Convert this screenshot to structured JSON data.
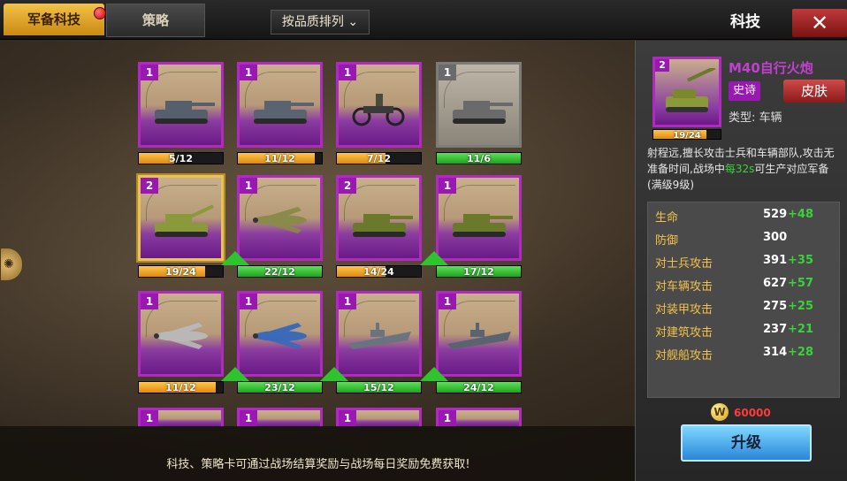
{
  "tabs": [
    {
      "label": "军备科技"
    },
    {
      "label": "策略"
    }
  ],
  "sort_label": "按品质排列",
  "header_title": "科技",
  "close_icon": "✕",
  "cards": [
    {
      "level": "1",
      "progress": "5/12",
      "bar": "orange",
      "fill": 0.42,
      "unit": "tank",
      "color": "#56606c"
    },
    {
      "level": "1",
      "progress": "11/12",
      "bar": "orange",
      "fill": 0.92,
      "unit": "tank-destroyer",
      "color": "#5a6470"
    },
    {
      "level": "1",
      "progress": "7/12",
      "bar": "orange",
      "fill": 0.58,
      "unit": "motorcycle",
      "color": "#3a3a3a"
    },
    {
      "level": "1",
      "progress": "11/6",
      "bar": "green",
      "fill": 1,
      "unit": "sp-gun-gray",
      "color": "#6a6a6a",
      "gray": true
    },
    {
      "level": "2",
      "progress": "19/24",
      "bar": "orange",
      "fill": 0.79,
      "unit": "sp-artillery",
      "color": "#8a9a3a",
      "selected": true
    },
    {
      "level": "1",
      "progress": "22/12",
      "bar": "green",
      "fill": 1,
      "unit": "plane-p47",
      "color": "#8a8a4a",
      "arrow": true
    },
    {
      "level": "2",
      "progress": "14/24",
      "bar": "orange",
      "fill": 0.58,
      "unit": "tank-green",
      "color": "#6a7a2a"
    },
    {
      "level": "1",
      "progress": "17/12",
      "bar": "green",
      "fill": 1,
      "unit": "tank-m36",
      "color": "#6a7a2a",
      "arrow": true
    },
    {
      "level": "1",
      "progress": "11/12",
      "bar": "orange",
      "fill": 0.92,
      "unit": "plane-spitfire",
      "color": "#b8b8b8"
    },
    {
      "level": "1",
      "progress": "23/12",
      "bar": "green",
      "fill": 1,
      "unit": "plane-corsair",
      "color": "#3a6ab8",
      "arrow": true
    },
    {
      "level": "1",
      "progress": "15/12",
      "bar": "green",
      "fill": 1,
      "unit": "warship",
      "color": "#6a7480",
      "arrow": true
    },
    {
      "level": "1",
      "progress": "24/12",
      "bar": "green",
      "fill": 1,
      "unit": "battleship",
      "color": "#5a6470",
      "arrow": true
    }
  ],
  "extra_row_levels": [
    "1",
    "1",
    "1",
    "1"
  ],
  "tip": "科技、策略卡可通过战场结算奖励与战场每日奖励免费获取!",
  "detail": {
    "level": "2",
    "progress": "19/24",
    "progress_fill": 0.79,
    "name": "M40自行火炮",
    "rarity": "史诗",
    "skin_label": "皮肤",
    "type_label": "类型: 车辆",
    "desc_prefix": "射程远,擅长攻击士兵和车辆部队,攻击无准备时间,战场中",
    "desc_highlight": "每32s",
    "desc_suffix": "可生产对应军备(满级9级)",
    "stats": [
      {
        "label": "生命",
        "value": "529",
        "bonus": "+48"
      },
      {
        "label": "防御",
        "value": "300",
        "bonus": ""
      },
      {
        "label": "对士兵攻击",
        "value": "391",
        "bonus": "+35"
      },
      {
        "label": "对车辆攻击",
        "value": "627",
        "bonus": "+57"
      },
      {
        "label": "对装甲攻击",
        "value": "275",
        "bonus": "+25"
      },
      {
        "label": "对建筑攻击",
        "value": "237",
        "bonus": "+21"
      },
      {
        "label": "对舰船攻击",
        "value": "314",
        "bonus": "+28"
      }
    ],
    "cost_icon": "W",
    "cost": "60000",
    "upgrade_label": "升级"
  }
}
